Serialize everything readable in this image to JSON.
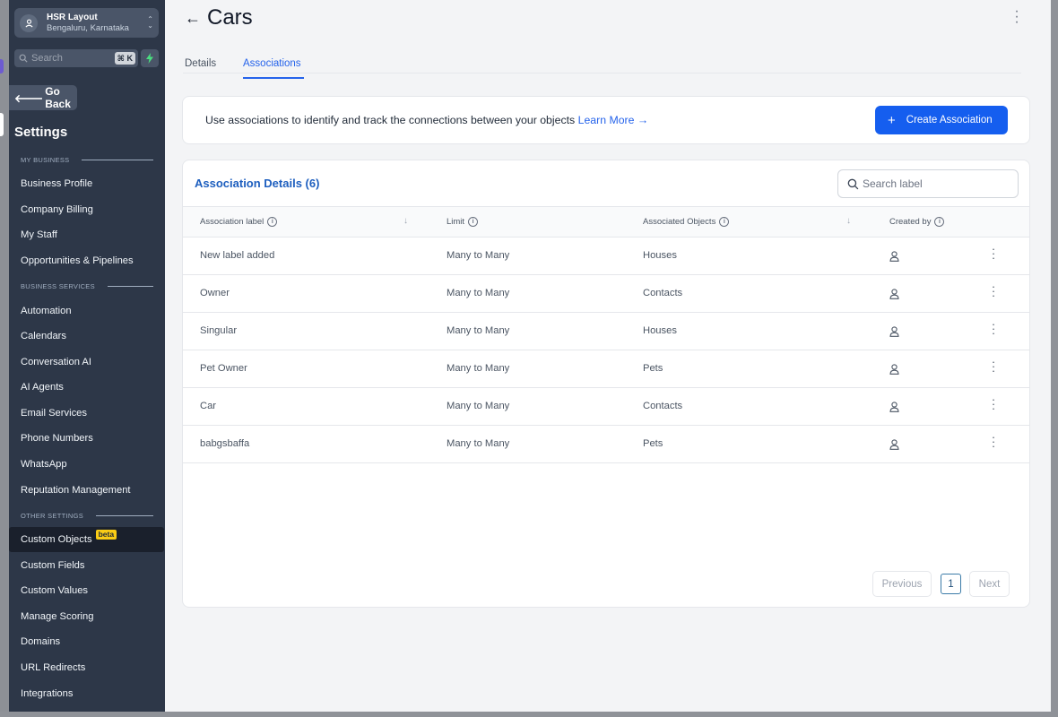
{
  "location": {
    "name": "HSR Layout",
    "address": "Bengaluru, Karnataka"
  },
  "search": {
    "placeholder": "Search",
    "shortcut": "⌘ K"
  },
  "sidebar": {
    "back_label": "Go Back",
    "title": "Settings",
    "sections": [
      {
        "label": "MY BUSINESS",
        "items": [
          "Business Profile",
          "Company Billing",
          "My Staff",
          "Opportunities & Pipelines"
        ]
      },
      {
        "label": "BUSINESS SERVICES",
        "items": [
          "Automation",
          "Calendars",
          "Conversation AI",
          "AI Agents",
          "Email Services",
          "Phone Numbers",
          "WhatsApp",
          "Reputation Management"
        ]
      },
      {
        "label": "OTHER SETTINGS",
        "items": [
          "Custom Objects",
          "Custom Fields",
          "Custom Values",
          "Manage Scoring",
          "Domains",
          "URL Redirects",
          "Integrations"
        ]
      }
    ],
    "active_item": "Custom Objects",
    "active_badge": "beta"
  },
  "page": {
    "title": "Cars"
  },
  "tabs": [
    {
      "label": "Details"
    },
    {
      "label": "Associations"
    }
  ],
  "active_tab": "Associations",
  "banner": {
    "text": "Use associations to identify and track the connections between your objects",
    "link": "Learn More",
    "button": "Create Association"
  },
  "table": {
    "title": "Association Details (6)",
    "search_placeholder": "Search label",
    "columns": [
      "Association label",
      "Limit",
      "Associated Objects",
      "Created by"
    ],
    "rows": [
      {
        "label": "New label added",
        "limit": "Many to Many",
        "object": "Houses"
      },
      {
        "label": "Owner",
        "limit": "Many to Many",
        "object": "Contacts"
      },
      {
        "label": "Singular",
        "limit": "Many to Many",
        "object": "Houses"
      },
      {
        "label": "Pet Owner",
        "limit": "Many to Many",
        "object": "Pets"
      },
      {
        "label": "Car",
        "limit": "Many to Many",
        "object": "Contacts"
      },
      {
        "label": "babgsbaffa",
        "limit": "Many to Many",
        "object": "Pets"
      }
    ]
  },
  "pagination": {
    "previous": "Previous",
    "current": "1",
    "next": "Next"
  },
  "colors": {
    "accent": "#155eef",
    "sidebar": "#2d3748",
    "beta": "#facc15",
    "link": "#2563eb"
  }
}
